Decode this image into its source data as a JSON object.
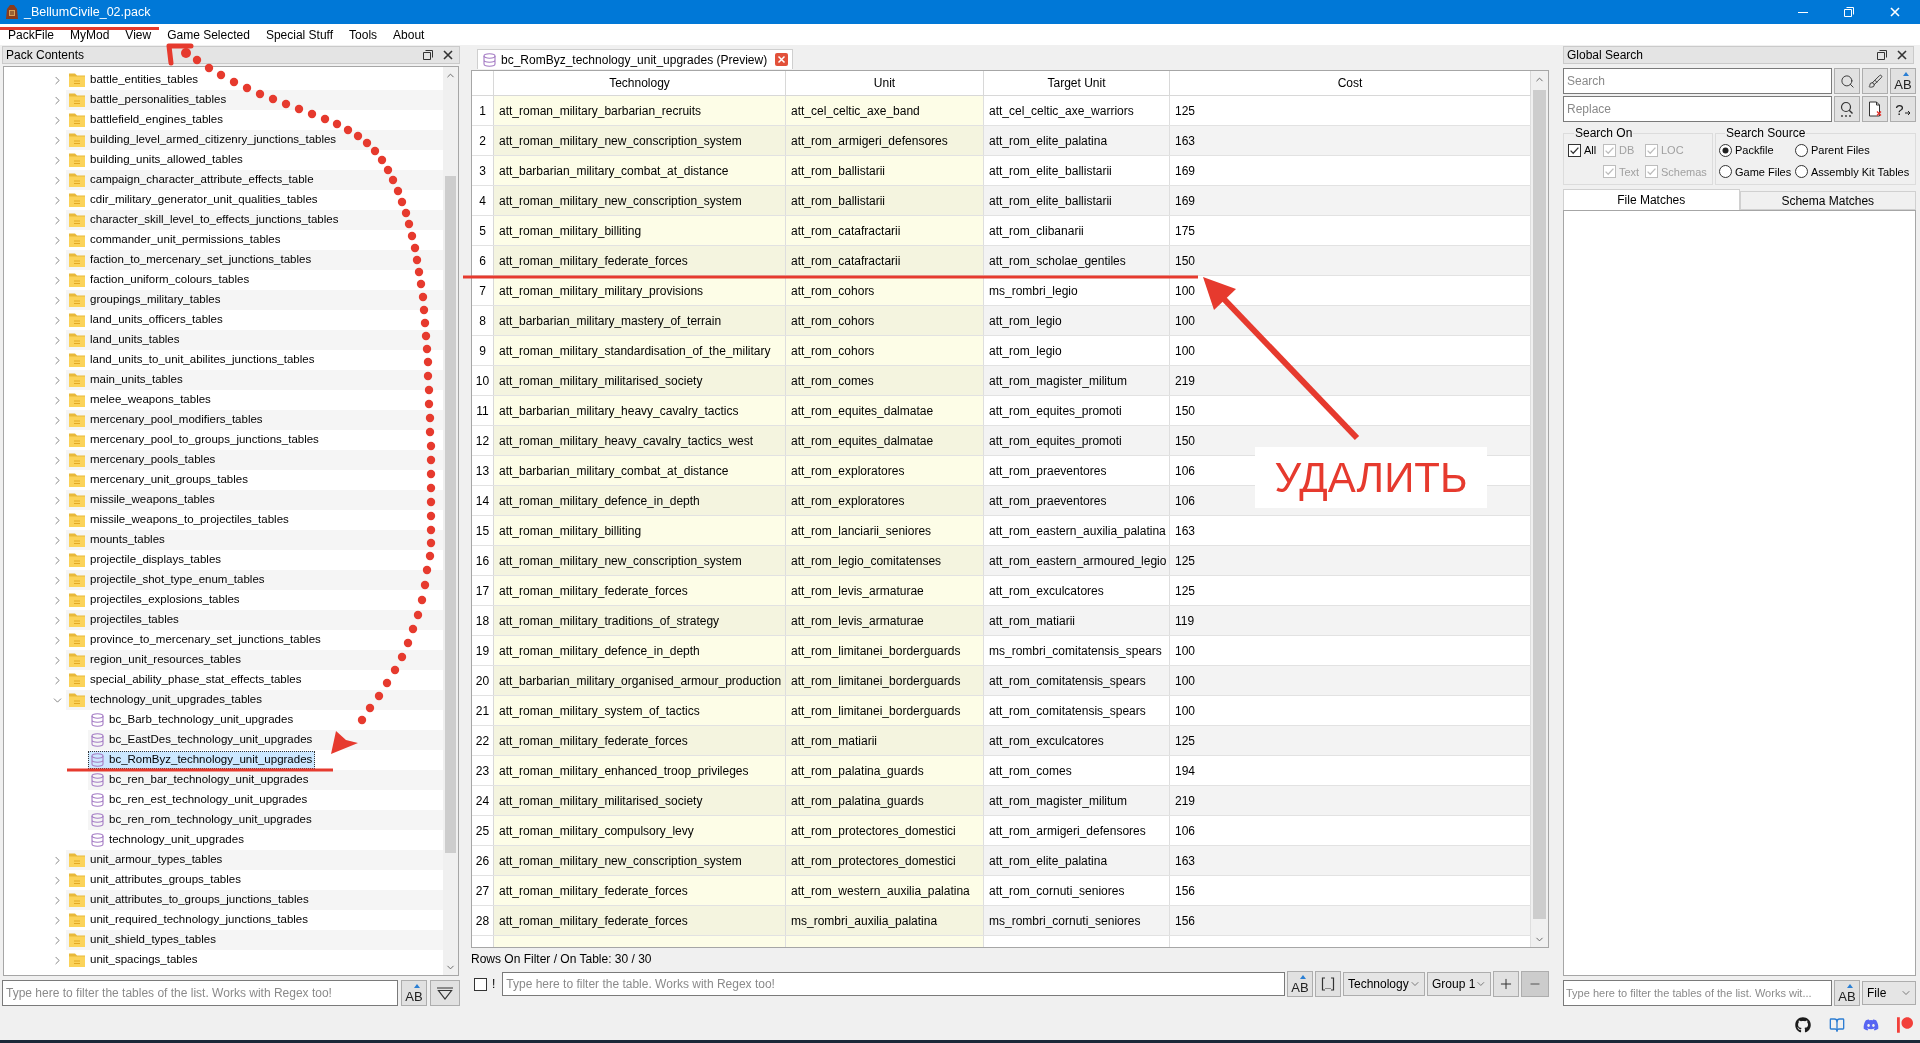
{
  "window": {
    "title": "_BellumCivile_02.pack"
  },
  "menu": [
    {
      "label": "PackFile",
      "crossed_out": true
    },
    {
      "label": "MyMod",
      "crossed_out": true
    },
    {
      "label": "View",
      "crossed_out": true
    },
    {
      "label": "Game Selected",
      "crossed_out": false
    },
    {
      "label": "Special Stuff",
      "crossed_out": false
    },
    {
      "label": "Tools",
      "crossed_out": false
    },
    {
      "label": "About",
      "crossed_out": false
    }
  ],
  "pack_contents": {
    "title": "Pack Contents",
    "tree": [
      {
        "kind": "folder",
        "label": "battle_entities_tables",
        "expanded": false,
        "selected": false
      },
      {
        "kind": "folder",
        "label": "battle_personalities_tables",
        "expanded": false,
        "selected": false
      },
      {
        "kind": "folder",
        "label": "battlefield_engines_tables",
        "expanded": false,
        "selected": false
      },
      {
        "kind": "folder",
        "label": "building_level_armed_citizenry_junctions_tables",
        "expanded": false,
        "selected": false
      },
      {
        "kind": "folder",
        "label": "building_units_allowed_tables",
        "expanded": false,
        "selected": false
      },
      {
        "kind": "folder",
        "label": "campaign_character_attribute_effects_table",
        "expanded": false,
        "selected": false
      },
      {
        "kind": "folder",
        "label": "cdir_military_generator_unit_qualities_tables",
        "expanded": false,
        "selected": false
      },
      {
        "kind": "folder",
        "label": "character_skill_level_to_effects_junctions_tables",
        "expanded": false,
        "selected": false
      },
      {
        "kind": "folder",
        "label": "commander_unit_permissions_tables",
        "expanded": false,
        "selected": false
      },
      {
        "kind": "folder",
        "label": "faction_to_mercenary_set_junctions_tables",
        "expanded": false,
        "selected": false
      },
      {
        "kind": "folder",
        "label": "faction_uniform_colours_tables",
        "expanded": false,
        "selected": false
      },
      {
        "kind": "folder",
        "label": "groupings_military_tables",
        "expanded": false,
        "selected": false
      },
      {
        "kind": "folder",
        "label": "land_units_officers_tables",
        "expanded": false,
        "selected": false
      },
      {
        "kind": "folder",
        "label": "land_units_tables",
        "expanded": false,
        "selected": false
      },
      {
        "kind": "folder",
        "label": "land_units_to_unit_abilites_junctions_tables",
        "expanded": false,
        "selected": false
      },
      {
        "kind": "folder",
        "label": "main_units_tables",
        "expanded": false,
        "selected": false
      },
      {
        "kind": "folder",
        "label": "melee_weapons_tables",
        "expanded": false,
        "selected": false
      },
      {
        "kind": "folder",
        "label": "mercenary_pool_modifiers_tables",
        "expanded": false,
        "selected": false
      },
      {
        "kind": "folder",
        "label": "mercenary_pool_to_groups_junctions_tables",
        "expanded": false,
        "selected": false
      },
      {
        "kind": "folder",
        "label": "mercenary_pools_tables",
        "expanded": false,
        "selected": false
      },
      {
        "kind": "folder",
        "label": "mercenary_unit_groups_tables",
        "expanded": false,
        "selected": false
      },
      {
        "kind": "folder",
        "label": "missile_weapons_tables",
        "expanded": false,
        "selected": false
      },
      {
        "kind": "folder",
        "label": "missile_weapons_to_projectiles_tables",
        "expanded": false,
        "selected": false
      },
      {
        "kind": "folder",
        "label": "mounts_tables",
        "expanded": false,
        "selected": false
      },
      {
        "kind": "folder",
        "label": "projectile_displays_tables",
        "expanded": false,
        "selected": false
      },
      {
        "kind": "folder",
        "label": "projectile_shot_type_enum_tables",
        "expanded": false,
        "selected": false
      },
      {
        "kind": "folder",
        "label": "projectiles_explosions_tables",
        "expanded": false,
        "selected": false
      },
      {
        "kind": "folder",
        "label": "projectiles_tables",
        "expanded": false,
        "selected": false
      },
      {
        "kind": "folder",
        "label": "province_to_mercenary_set_junctions_tables",
        "expanded": false,
        "selected": false
      },
      {
        "kind": "folder",
        "label": "region_unit_resources_tables",
        "expanded": false,
        "selected": false
      },
      {
        "kind": "folder",
        "label": "special_ability_phase_stat_effects_tables",
        "expanded": false,
        "selected": false
      },
      {
        "kind": "folder",
        "label": "technology_unit_upgrades_tables",
        "expanded": true,
        "selected": false,
        "children": [
          {
            "kind": "table",
            "label": "bc_Barb_technology_unit_upgrades",
            "selected": false
          },
          {
            "kind": "table",
            "label": "bc_EastDes_technology_unit_upgrades",
            "selected": false
          },
          {
            "kind": "table",
            "label": "bc_RomByz_technology_unit_upgrades",
            "selected": true
          },
          {
            "kind": "table",
            "label": "bc_ren_bar_technology_unit_upgrades",
            "selected": false
          },
          {
            "kind": "table",
            "label": "bc_ren_est_technology_unit_upgrades",
            "selected": false
          },
          {
            "kind": "table",
            "label": "bc_ren_rom_technology_unit_upgrades",
            "selected": false
          },
          {
            "kind": "table",
            "label": "technology_unit_upgrades",
            "selected": false
          }
        ]
      },
      {
        "kind": "folder",
        "label": "unit_armour_types_tables",
        "expanded": false,
        "selected": false
      },
      {
        "kind": "folder",
        "label": "unit_attributes_groups_tables",
        "expanded": false,
        "selected": false
      },
      {
        "kind": "folder",
        "label": "unit_attributes_to_groups_junctions_tables",
        "expanded": false,
        "selected": false
      },
      {
        "kind": "folder",
        "label": "unit_required_technology_junctions_tables",
        "expanded": false,
        "selected": false
      },
      {
        "kind": "folder",
        "label": "unit_shield_types_tables",
        "expanded": false,
        "selected": false
      },
      {
        "kind": "folder",
        "label": "unit_spacings_tables",
        "expanded": false,
        "selected": false
      }
    ],
    "filter": {
      "placeholder": "Type here to filter the tables of the list. Works with Regex too!"
    },
    "case_button": {
      "label": "AB"
    }
  },
  "editor": {
    "tabs": [
      {
        "label": "bc_RomByz_technology_unit_upgrades (Preview)",
        "selected": true
      }
    ],
    "table": {
      "columns": [
        {
          "label": "Technology",
          "key": true
        },
        {
          "label": "Unit",
          "key": true
        },
        {
          "label": "Target Unit",
          "key": false
        },
        {
          "label": "Cost",
          "key": false
        }
      ],
      "rows": [
        {
          "number": "1",
          "cells": [
            "att_roman_military_barbarian_recruits",
            "att_cel_celtic_axe_band",
            "att_cel_celtic_axe_warriors",
            "125"
          ]
        },
        {
          "number": "2",
          "cells": [
            "att_roman_military_new_conscription_system",
            "att_rom_armigeri_defensores",
            "att_rom_elite_palatina",
            "163"
          ]
        },
        {
          "number": "3",
          "cells": [
            "att_barbarian_military_combat_at_distance",
            "att_rom_ballistarii",
            "att_rom_elite_ballistarii",
            "169"
          ]
        },
        {
          "number": "4",
          "cells": [
            "att_roman_military_new_conscription_system",
            "att_rom_ballistarii",
            "att_rom_elite_ballistarii",
            "169"
          ]
        },
        {
          "number": "5",
          "cells": [
            "att_roman_military_billiting",
            "att_rom_catafractarii",
            "att_rom_clibanarii",
            "175"
          ]
        },
        {
          "number": "6",
          "cells": [
            "att_roman_military_federate_forces",
            "att_rom_catafractarii",
            "att_rom_scholae_gentiles",
            "150"
          ]
        },
        {
          "number": "7",
          "cells": [
            "att_roman_military_military_provisions",
            "att_rom_cohors",
            "ms_rombri_legio",
            "100"
          ]
        },
        {
          "number": "8",
          "cells": [
            "att_barbarian_military_mastery_of_terrain",
            "att_rom_cohors",
            "att_rom_legio",
            "100"
          ]
        },
        {
          "number": "9",
          "cells": [
            "att_roman_military_standardisation_of_the_military",
            "att_rom_cohors",
            "att_rom_legio",
            "100"
          ]
        },
        {
          "number": "10",
          "cells": [
            "att_roman_military_militarised_society",
            "att_rom_comes",
            "att_rom_magister_militum",
            "219"
          ]
        },
        {
          "number": "11",
          "cells": [
            "att_barbarian_military_heavy_cavalry_tactics",
            "att_rom_equites_dalmatae",
            "att_rom_equites_promoti",
            "150"
          ]
        },
        {
          "number": "12",
          "cells": [
            "att_roman_military_heavy_cavalry_tactics_west",
            "att_rom_equites_dalmatae",
            "att_rom_equites_promoti",
            "150"
          ]
        },
        {
          "number": "13",
          "cells": [
            "att_barbarian_military_combat_at_distance",
            "att_rom_exploratores",
            "att_rom_praeventores",
            "106"
          ]
        },
        {
          "number": "14",
          "cells": [
            "att_roman_military_defence_in_depth",
            "att_rom_exploratores",
            "att_rom_praeventores",
            "106"
          ]
        },
        {
          "number": "15",
          "cells": [
            "att_roman_military_billiting",
            "att_rom_lanciarii_seniores",
            "att_rom_eastern_auxilia_palatina",
            "163"
          ]
        },
        {
          "number": "16",
          "cells": [
            "att_roman_military_new_conscription_system",
            "att_rom_legio_comitatenses",
            "att_rom_eastern_armoured_legio",
            "125"
          ]
        },
        {
          "number": "17",
          "cells": [
            "att_roman_military_federate_forces",
            "att_rom_levis_armaturae",
            "att_rom_exculcatores",
            "125"
          ]
        },
        {
          "number": "18",
          "cells": [
            "att_roman_military_traditions_of_strategy",
            "att_rom_levis_armaturae",
            "att_rom_matiarii",
            "119"
          ]
        },
        {
          "number": "19",
          "cells": [
            "att_roman_military_defence_in_depth",
            "att_rom_limitanei_borderguards",
            "ms_rombri_comitatensis_spears",
            "100"
          ]
        },
        {
          "number": "20",
          "cells": [
            "att_barbarian_military_organised_armour_production",
            "att_rom_limitanei_borderguards",
            "att_rom_comitatensis_spears",
            "100"
          ]
        },
        {
          "number": "21",
          "cells": [
            "att_roman_military_system_of_tactics",
            "att_rom_limitanei_borderguards",
            "att_rom_comitatensis_spears",
            "100"
          ]
        },
        {
          "number": "22",
          "cells": [
            "att_roman_military_federate_forces",
            "att_rom_matiarii",
            "att_rom_exculcatores",
            "125"
          ]
        },
        {
          "number": "23",
          "cells": [
            "att_roman_military_enhanced_troop_privileges",
            "att_rom_palatina_guards",
            "att_rom_comes",
            "194"
          ]
        },
        {
          "number": "24",
          "cells": [
            "att_roman_military_militarised_society",
            "att_rom_palatina_guards",
            "att_rom_magister_militum",
            "219"
          ]
        },
        {
          "number": "25",
          "cells": [
            "att_roman_military_compulsory_levy",
            "att_rom_protectores_domestici",
            "att_rom_armigeri_defensores",
            "106"
          ]
        },
        {
          "number": "26",
          "cells": [
            "att_roman_military_new_conscription_system",
            "att_rom_protectores_domestici",
            "att_rom_elite_palatina",
            "163"
          ]
        },
        {
          "number": "27",
          "cells": [
            "att_roman_military_federate_forces",
            "att_rom_western_auxilia_palatina",
            "att_rom_cornuti_seniores",
            "156"
          ]
        },
        {
          "number": "28",
          "cells": [
            "att_roman_military_federate_forces",
            "ms_rombri_auxilia_palatina",
            "ms_rombri_cornuti_seniores",
            "156"
          ]
        }
      ]
    },
    "status": "Rows On Filter / On Table: 30 / 30",
    "filter_bar": {
      "checked": false,
      "invert_label": "!",
      "placeholder": "Type here to filter the table. Works with Regex too!",
      "case_button": {
        "label": "AB"
      },
      "column": "Technology",
      "group": "Group 1"
    }
  },
  "global_search": {
    "title": "Global Search",
    "search": {
      "placeholder": "Search"
    },
    "replace": {
      "placeholder": "Replace"
    },
    "case_button": {
      "label": "AB"
    },
    "regex_button": {
      "label": "?"
    },
    "search_on": {
      "title": "Search On",
      "options": [
        {
          "label": "All",
          "checked": true,
          "disabled": false
        },
        {
          "label": "DB",
          "checked": true,
          "disabled": true
        },
        {
          "label": "LOC",
          "checked": true,
          "disabled": true
        },
        {
          "label": "Text",
          "checked": true,
          "disabled": true
        },
        {
          "label": "Schemas",
          "checked": true,
          "disabled": true
        }
      ]
    },
    "search_source": {
      "title": "Search Source",
      "options": [
        {
          "label": "Packfile",
          "selected": true
        },
        {
          "label": "Parent Files",
          "selected": false
        },
        {
          "label": "Game Files",
          "selected": false
        },
        {
          "label": "Assembly Kit Tables",
          "selected": false
        }
      ]
    },
    "tabs": [
      {
        "label": "File Matches",
        "selected": true
      },
      {
        "label": "Schema Matches",
        "selected": false
      }
    ],
    "filter": {
      "placeholder": "Type here to filter the tables of the list. Works wit..."
    },
    "filter_case_button": {
      "label": "AB"
    },
    "source": "File"
  },
  "annotation": {
    "label": "УДАЛИТЬ"
  }
}
